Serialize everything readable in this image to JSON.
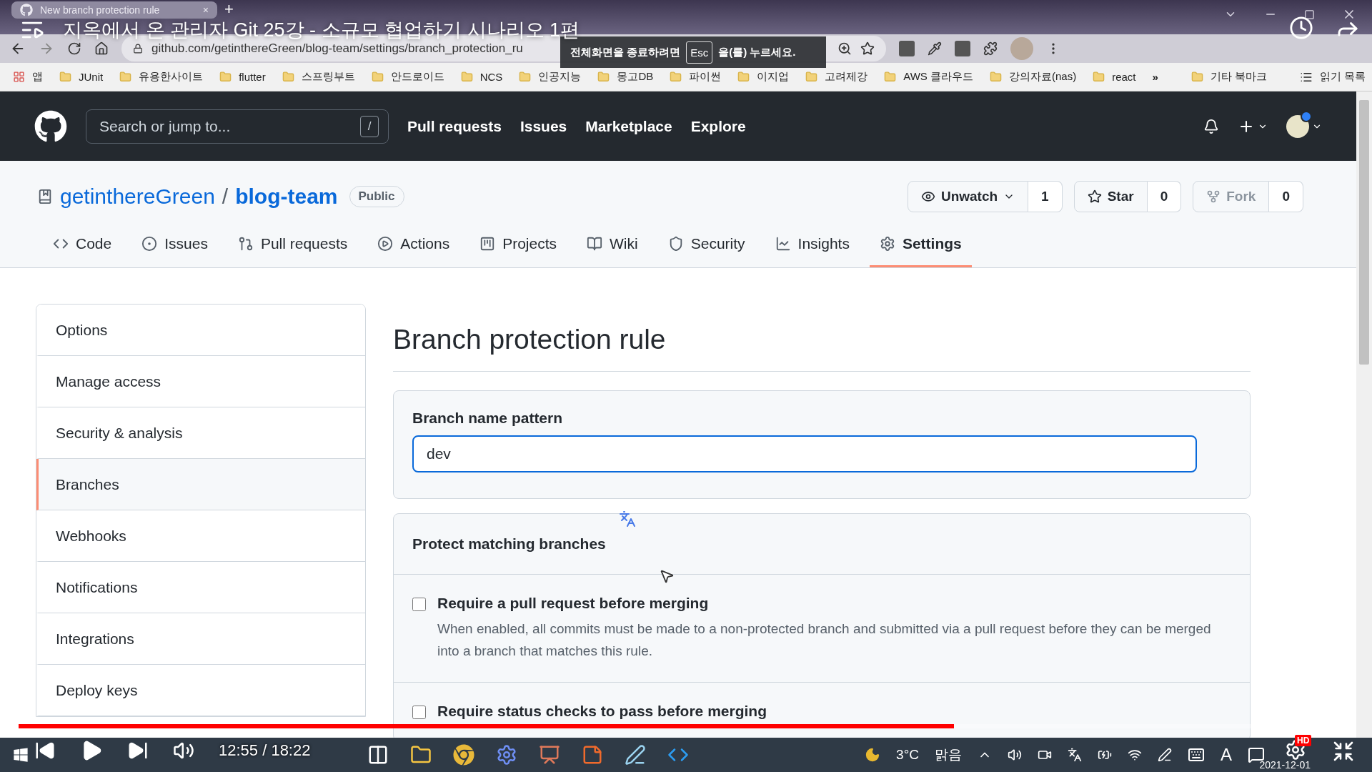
{
  "video": {
    "title": "지옥에서 온 관리자 Git 25강 - 소규모 협업하기 시나리오 1편",
    "time": "12:55 / 18:22",
    "progress": {
      "level": 0.7
    },
    "quality_badge": "HD"
  },
  "fullscreen_notice": {
    "before": "전체화면을 종료하려면",
    "key": "Esc",
    "after": "을(를) 누르세요."
  },
  "browser": {
    "tab": {
      "title": "New branch protection rule",
      "close": "×"
    },
    "new_tab": "+",
    "url": "github.com/getinthereGreen/blog-team/settings/branch_protection_ru",
    "bookmarks": [
      {
        "label": "앱",
        "kind": "apps"
      },
      {
        "label": "JUnit",
        "kind": "folder"
      },
      {
        "label": "유용한사이트",
        "kind": "folder"
      },
      {
        "label": "flutter",
        "kind": "folder"
      },
      {
        "label": "스프링부트",
        "kind": "folder"
      },
      {
        "label": "안드로이드",
        "kind": "folder"
      },
      {
        "label": "NCS",
        "kind": "folder"
      },
      {
        "label": "인공지능",
        "kind": "folder"
      },
      {
        "label": "몽고DB",
        "kind": "folder"
      },
      {
        "label": "파이썬",
        "kind": "folder"
      },
      {
        "label": "이지업",
        "kind": "folder"
      },
      {
        "label": "고려제강",
        "kind": "folder"
      },
      {
        "label": "AWS 클라우드",
        "kind": "folder"
      },
      {
        "label": "강의자료(nas)",
        "kind": "folder"
      },
      {
        "label": "react",
        "kind": "folder"
      }
    ],
    "overflow": "»",
    "other_bookmarks": "기타 북마크",
    "reading_list": "읽기 목록"
  },
  "github": {
    "search_placeholder": "Search or jump to...",
    "search_key": "/",
    "nav": [
      "Pull requests",
      "Issues",
      "Marketplace",
      "Explore"
    ],
    "owner": "getinthereGreen",
    "separator": "/",
    "repo": "blog-team",
    "visibility": "Public",
    "repo_actions": [
      {
        "label": "Unwatch",
        "count": "1",
        "kind": "watch",
        "disabled": false
      },
      {
        "label": "Star",
        "count": "0",
        "kind": "star",
        "disabled": false
      },
      {
        "label": "Fork",
        "count": "0",
        "kind": "fork",
        "disabled": true
      }
    ],
    "tabs": [
      {
        "label": "Code",
        "kind": "code",
        "selected": false
      },
      {
        "label": "Issues",
        "kind": "issues",
        "selected": false
      },
      {
        "label": "Pull requests",
        "kind": "pulls",
        "selected": false
      },
      {
        "label": "Actions",
        "kind": "actions",
        "selected": false
      },
      {
        "label": "Projects",
        "kind": "projects",
        "selected": false
      },
      {
        "label": "Wiki",
        "kind": "wiki",
        "selected": false
      },
      {
        "label": "Security",
        "kind": "security",
        "selected": false
      },
      {
        "label": "Insights",
        "kind": "insights",
        "selected": false
      },
      {
        "label": "Settings",
        "kind": "settings",
        "selected": true
      }
    ]
  },
  "sidebar": {
    "items": [
      {
        "label": "Options",
        "selected": false
      },
      {
        "label": "Manage access",
        "selected": false
      },
      {
        "label": "Security & analysis",
        "selected": false
      },
      {
        "label": "Branches",
        "selected": true
      },
      {
        "label": "Webhooks",
        "selected": false
      },
      {
        "label": "Notifications",
        "selected": false
      },
      {
        "label": "Integrations",
        "selected": false
      },
      {
        "label": "Deploy keys",
        "selected": false
      }
    ]
  },
  "rule": {
    "title": "Branch protection rule",
    "pattern_label": "Branch name pattern",
    "pattern_value": "dev",
    "section_title": "Protect matching branches",
    "options": [
      {
        "label": "Require a pull request before merging",
        "description": "When enabled, all commits must be made to a non-protected branch and submitted via a pull request before they can be merged into a branch that matches this rule.",
        "checked": false
      },
      {
        "label": "Require status checks to pass before merging",
        "checked": false
      }
    ]
  },
  "taskbar": {
    "apps": [
      {
        "kind": "taskview"
      },
      {
        "kind": "explorer"
      },
      {
        "kind": "chrome"
      },
      {
        "kind": "settings"
      },
      {
        "kind": "slides"
      },
      {
        "kind": "notes"
      },
      {
        "kind": "notepad"
      },
      {
        "kind": "vscode"
      }
    ],
    "temperature": "3°C",
    "weather": "맑음",
    "ime": "A",
    "date": "2021-12-01"
  }
}
